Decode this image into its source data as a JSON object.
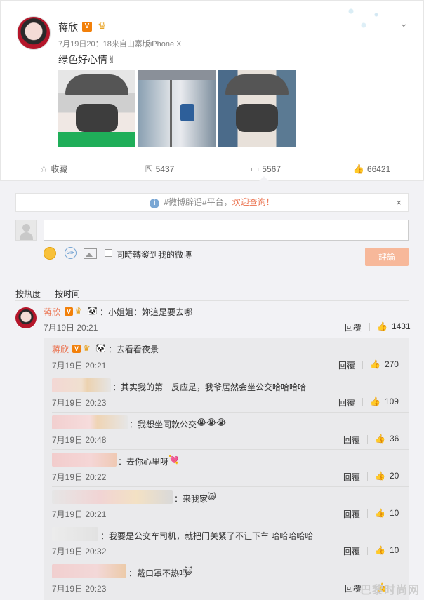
{
  "post": {
    "author": "蒋欣",
    "v_badge": "V",
    "meta": "7月19日20：18来自山寨版iPhone X",
    "text": "绿色好心情✌",
    "images": [
      "image-1",
      "image-2",
      "image-3"
    ],
    "actions": [
      {
        "icon": "star-icon",
        "label": "收藏"
      },
      {
        "icon": "share-icon",
        "label": "5437"
      },
      {
        "icon": "comment-icon",
        "label": "5567"
      },
      {
        "icon": "thumbs-up-icon",
        "label": "66421"
      }
    ]
  },
  "notice": {
    "prefix": "#微博辟谣#平台，",
    "link": "欢迎查询！",
    "close": "×"
  },
  "composer": {
    "checkbox_label": "同時轉發到我的微博",
    "submit_label": "評論",
    "gif_label": "GIF"
  },
  "sort": {
    "hot": "按热度",
    "time": "按时间"
  },
  "comment": {
    "author": "蒋欣",
    "text": "：小姐姐：妳這是要去哪",
    "time": "7月19日 20:21",
    "reply": "回覆",
    "likes": "1431"
  },
  "replies": [
    {
      "author": "蒋欣",
      "text": "：去看看夜景",
      "time": "7月19日 20:21",
      "reply": "回覆",
      "likes": "270"
    },
    {
      "author": "",
      "text": "：其实我的第一反应是，我爷居然会坐公交哈哈哈哈",
      "time": "7月19日 20:23",
      "reply": "回覆",
      "likes": "109"
    },
    {
      "author": "",
      "text": "：我想坐同款公交",
      "time": "7月19日 20:48",
      "reply": "回覆",
      "likes": "36"
    },
    {
      "author": "",
      "text": "：去你心里呀",
      "time": "7月19日 20:22",
      "reply": "回覆",
      "likes": "20"
    },
    {
      "author": "",
      "text": "：来我家",
      "time": "7月19日 20:21",
      "reply": "回覆",
      "likes": "10"
    },
    {
      "author": "",
      "text": "：我要是公交车司机，就把门关紧了不让下车 哈哈哈哈哈",
      "time": "7月19日 20:32",
      "reply": "回覆",
      "likes": "10"
    },
    {
      "author": "",
      "text": "：戴口罩不热吗",
      "time": "7月19日 20:23",
      "reply": "回覆",
      "likes": ""
    }
  ],
  "watermark": "巴黎时尚网",
  "colors": {
    "accent": "#eb7350",
    "badge": "#f2800a",
    "submit": "#f7b89a"
  }
}
